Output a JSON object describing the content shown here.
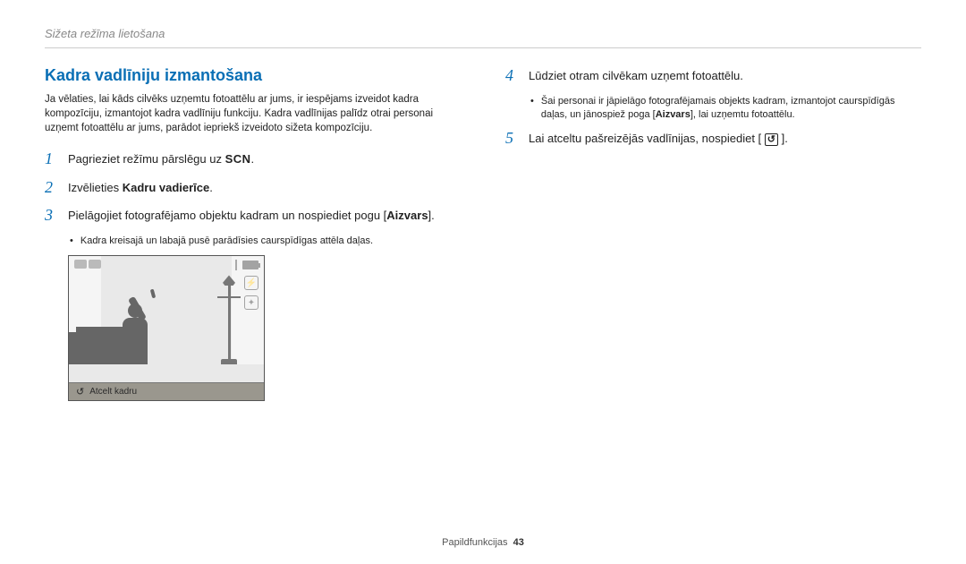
{
  "header": {
    "breadcrumb": "Sižeta režīma lietošana"
  },
  "section": {
    "title": "Kadra vadlīniju izmantošana"
  },
  "intro": "Ja vēlaties, lai kāds cilvēks uzņemtu fotoattēlu ar jums, ir iespējams izveidot kadra kompozīciju, izmantojot kadra vadlīniju funkciju. Kadra vadlīnijas palīdz otrai personai uzņemt fotoattēlu ar jums, parādot iepriekš izveidoto sižeta kompozīciju.",
  "steps": [
    {
      "num": "1",
      "text_before": "Pagrieziet režīmu pārslēgu uz ",
      "icon": "SCN",
      "text_after": "."
    },
    {
      "num": "2",
      "text_before": "Izvēlieties ",
      "bold": "Kadru vadierīce",
      "text_after": "."
    },
    {
      "num": "3",
      "text_before": "Pielāgojiet fotografējamo objektu kadram un nospiediet pogu [",
      "bold": "Aizvars",
      "text_after": "]."
    },
    {
      "note1": "Kadra kreisajā un labajā pusē parādīsies caurspīdīgas attēla daļas."
    },
    {
      "num": "4",
      "text_before": "Lūdziet otram cilvēkam uzņemt fotoattēlu."
    },
    {
      "note2_before": "Šai personai ir jāpielāgo fotografējamais objekts kadram, izmantojot caurspīdīgās daļas, un jānospiež poga [",
      "note2_bold": "Aizvars",
      "note2_after": "], lai uzņemtu fotoattēlu."
    },
    {
      "num": "5",
      "text_before": "Lai atceltu pašreizējās vadlīnijas, nospiediet [ ",
      "return_icon": "↺",
      "text_after": " ]."
    }
  ],
  "camera": {
    "cancel_label": "Atcelt kadru",
    "back_symbol": "↺"
  },
  "footer": {
    "label": "Papildfunkcijas",
    "page": "43"
  }
}
